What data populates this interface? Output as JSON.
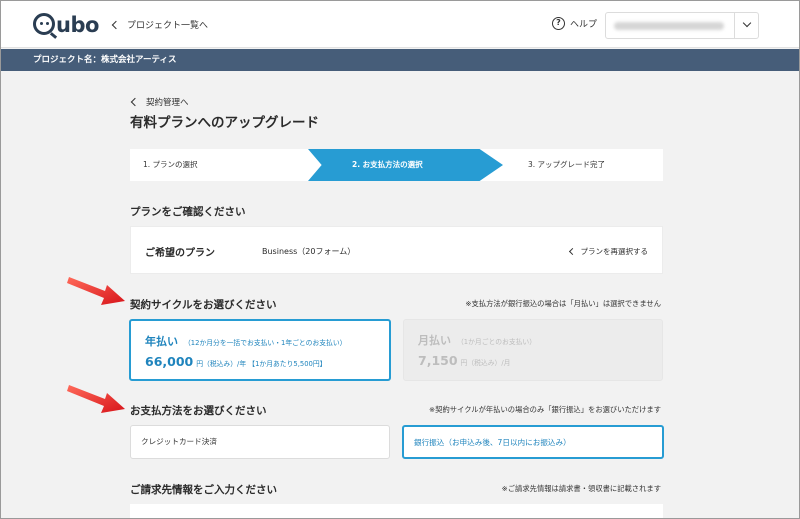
{
  "header": {
    "logo_text": "ubo",
    "back_label": "プロジェクト一覧へ",
    "help_label": "ヘルプ"
  },
  "project_bar": {
    "label": "プロジェクト名：株式会社アーティス"
  },
  "breadcrumb": {
    "label": "契約管理へ"
  },
  "page_title": "有料プランへのアップグレード",
  "stepper": {
    "steps": [
      {
        "label": "1. プランの選択"
      },
      {
        "label": "2. お支払方法の選択"
      },
      {
        "label": "3. アップグレード完了"
      }
    ],
    "active_index": 1
  },
  "plan_section": {
    "title": "プランをご確認ください",
    "desired_label": "ご希望のプラン",
    "plan_value": "Business（20フォーム）",
    "reselect_label": "プランを再選択する"
  },
  "cycle_section": {
    "title": "契約サイクルをお選びください",
    "note": "※支払方法が銀行振込の場合は「月払い」は選択できません",
    "options": [
      {
        "name": "年払い",
        "desc": "（12か月分を一括でお支払い・1年ごとのお支払い）",
        "price": "66,000",
        "unit": "円（税込み）/年 【1か月あたり5,500円】",
        "selected": true
      },
      {
        "name": "月払い",
        "desc": "（1か月ごとのお支払い）",
        "price": "7,150",
        "unit": "円（税込み）/月",
        "selected": false
      }
    ]
  },
  "payment_section": {
    "title": "お支払方法をお選びください",
    "note": "※契約サイクルが年払いの場合のみ「銀行振込」をお選びいただけます",
    "options": [
      {
        "label": "クレジットカード決済",
        "selected": false
      },
      {
        "label": "銀行振込（お申込み後、7日以内にお振込み）",
        "selected": true
      }
    ]
  },
  "billing_section": {
    "title": "ご請求先情報をご入力ください",
    "note": "※ご請求先情報は請求書・領収書に記載されます"
  },
  "colors": {
    "accent": "#279cd3",
    "navy": "#465d79",
    "annotation_arrow": "#e8262a"
  }
}
